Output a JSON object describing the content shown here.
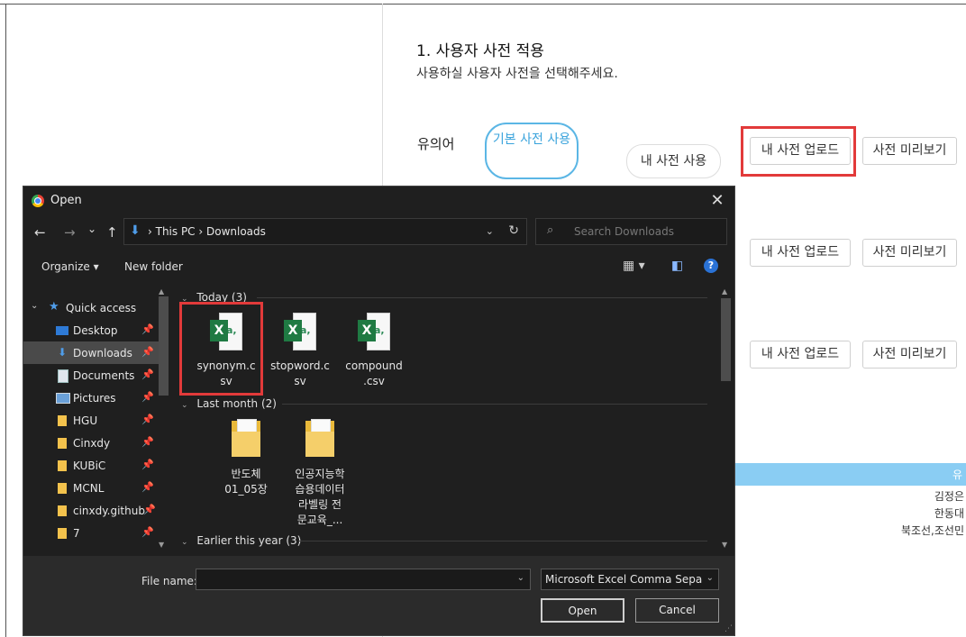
{
  "page": {
    "section_title": "1. 사용자 사전 적용",
    "section_subtitle": "사용하실 사용자 사전을 선택해주세요.",
    "row_label": "유의어",
    "default_dict_button": "기본 사전 사용",
    "my_dict_button": "내 사전 사용",
    "upload_button": "내 사전 업로드",
    "preview_button": "사전 미리보기",
    "footer_bar_text": "유",
    "footer_lines": [
      "김정은",
      "한동대",
      "북조선,조선민"
    ]
  },
  "dialog": {
    "title": "Open",
    "close_label": "✕",
    "nav": {
      "back": "←",
      "forward": "→",
      "recent": "⌄",
      "up": "↑",
      "breadcrumb": "›  This PC  ›  Downloads",
      "address_chevron": "⌄",
      "refresh": "↻",
      "search_placeholder": "Search Downloads"
    },
    "toolbar": {
      "organize": "Organize ▾",
      "new_folder": "New folder",
      "view_icon": "▦ ▾",
      "pane_icon": "◧",
      "help": "?"
    },
    "sidebar": {
      "quick_access": "Quick access",
      "items": [
        {
          "label": "Desktop",
          "icon": "desktop-icon"
        },
        {
          "label": "Downloads",
          "icon": "downloads-icon"
        },
        {
          "label": "Documents",
          "icon": "documents-icon"
        },
        {
          "label": "Pictures",
          "icon": "pictures-icon"
        },
        {
          "label": "HGU",
          "icon": "folder-icon"
        },
        {
          "label": "Cinxdy",
          "icon": "folder-icon"
        },
        {
          "label": "KUBiC",
          "icon": "folder-icon"
        },
        {
          "label": "MCNL",
          "icon": "folder-icon"
        },
        {
          "label": "cinxdy.github",
          "icon": "folder-icon"
        },
        {
          "label": "7",
          "icon": "folder-icon"
        }
      ]
    },
    "groups": {
      "today": "Today (3)",
      "last_month": "Last month (2)",
      "earlier": "Earlier this year (3)"
    },
    "files_today": [
      {
        "line1": "synonym.c",
        "line2": "sv"
      },
      {
        "line1": "stopword.c",
        "line2": "sv"
      },
      {
        "line1": "compound",
        "line2": ".csv"
      }
    ],
    "files_last_month": [
      {
        "lines": [
          "반도체",
          "01_05장"
        ]
      },
      {
        "lines": [
          "인공지능학",
          "습용데이터",
          "라벨링 전",
          "문교육_..."
        ]
      }
    ],
    "file_name_label": "File name:",
    "file_name_value": "",
    "file_type": "Microsoft Excel Comma Separated",
    "open_button": "Open",
    "cancel_button": "Cancel"
  }
}
